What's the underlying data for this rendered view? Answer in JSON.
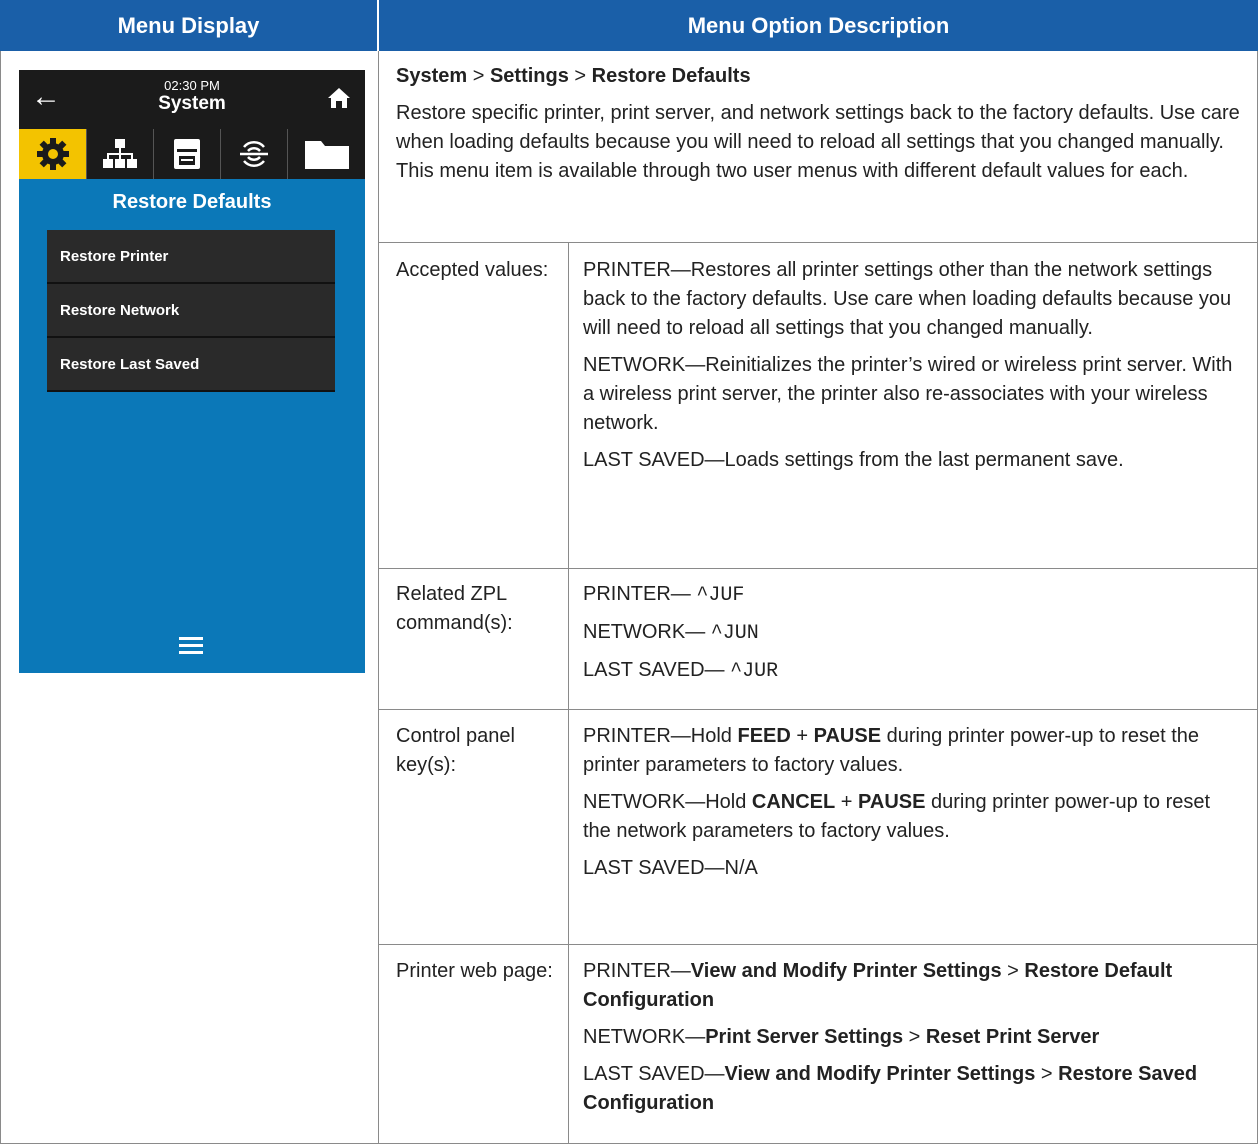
{
  "header": {
    "left": "Menu Display",
    "right": "Menu Option Description"
  },
  "screen": {
    "time": "02:30 PM",
    "title": "System",
    "heading": "Restore Defaults",
    "items": [
      "Restore Printer",
      "Restore Network",
      "Restore Last Saved"
    ],
    "tabs": [
      "gear-icon",
      "network-icon",
      "printer-icon",
      "wireless-icon",
      "folder-icon"
    ],
    "colors": {
      "screen_bg": "#0b78b8",
      "active_tab": "#f3c300",
      "header_bg": "#1a5fa8"
    }
  },
  "desc": {
    "breadcrumb": {
      "a": "System",
      "sep1": " > ",
      "b": "Settings",
      "sep2": " > ",
      "c": "Restore Defaults"
    },
    "intro": "Restore specific printer, print server, and network settings back to the factory defaults. Use care when loading defaults because you will need to reload all settings that you changed manually. This menu item is available through two user menus with different default values for each.",
    "rows": {
      "accepted": {
        "label": "Accepted values:",
        "printer": "PRINTER—Restores all printer settings other than the network settings back to the factory defaults. Use care when loading defaults because you will need to reload all settings that you changed manually.",
        "network": "NETWORK—Reinitializes the printer’s wired or wireless print server. With a wireless print server, the printer also re-associates with your wireless network.",
        "last": "LAST SAVED—Loads settings from the last permanent save."
      },
      "zpl": {
        "label": "Related ZPL command(s):",
        "printer_prefix": "PRINTER— ",
        "printer_cmd": "^JUF",
        "network_prefix": "NETWORK— ",
        "network_cmd": "^JUN",
        "last_prefix": "LAST SAVED— ",
        "last_cmd": "^JUR"
      },
      "keys": {
        "label": "Control panel key(s):",
        "p1": "PRINTER—Hold ",
        "p_feed": "FEED",
        "p_plus": " + ",
        "p_pause": "PAUSE",
        "p2": " during printer power-up to reset the printer parameters to factory values.",
        "n1": "NETWORK—Hold ",
        "n_cancel": "CANCEL",
        "n_plus": " + ",
        "n_pause": "PAUSE",
        "n2": " during printer power-up to reset the network parameters to factory values.",
        "last": "LAST SAVED—N/A"
      },
      "web": {
        "label": "Printer web page:",
        "p1": "PRINTER—",
        "p_a": "View and Modify Printer Settings",
        "p_sep": " > ",
        "p_b": "Restore Default Configuration",
        "n1": "NETWORK—",
        "n_a": "Print Server Settings",
        "n_sep": " > ",
        "n_b": "Reset Print Server",
        "l1": "LAST SAVED—",
        "l_a": "View and Modify Printer Settings",
        "l_sep": " > ",
        "l_b": "Restore Saved Configuration"
      }
    }
  }
}
